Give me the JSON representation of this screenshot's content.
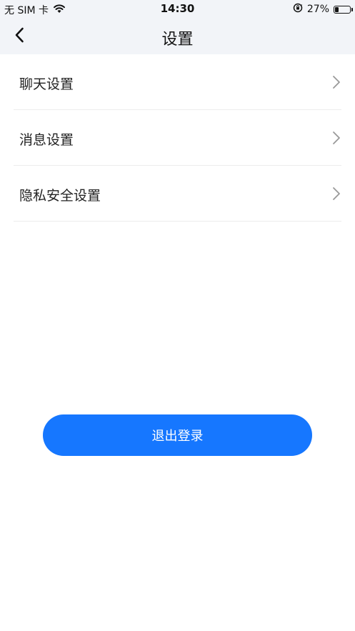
{
  "status_bar": {
    "carrier": "无 SIM 卡",
    "time": "14:30",
    "battery_text": "27%",
    "battery_level": 0.27
  },
  "nav": {
    "title": "设置"
  },
  "settings": {
    "items": [
      {
        "label": "聊天设置"
      },
      {
        "label": "消息设置"
      },
      {
        "label": "隐私安全设置"
      }
    ]
  },
  "logout": {
    "label": "退出登录"
  },
  "colors": {
    "accent": "#1677ff",
    "header_bg": "#f2f4f8"
  }
}
